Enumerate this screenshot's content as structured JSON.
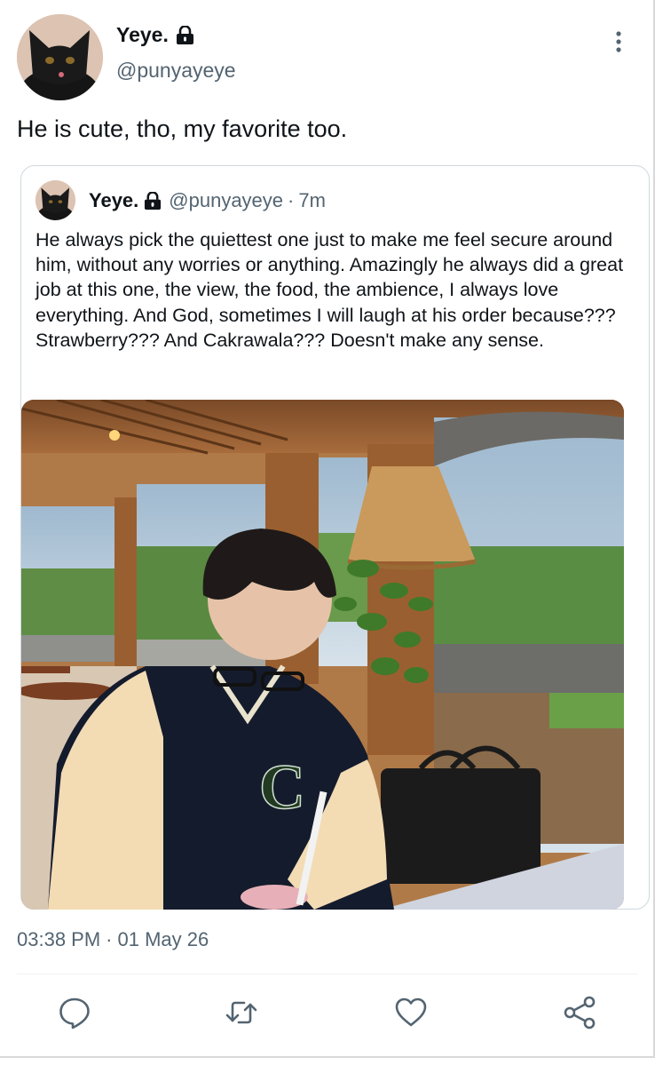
{
  "tweet": {
    "author": {
      "display_name": "Yeye.",
      "handle": "@punyayeye",
      "avatar": "black-cat-avatar",
      "protected_icon": "lock-icon"
    },
    "text": "He is cute, tho, my favorite too.",
    "timestamp_time": "03:38 PM",
    "timestamp_sep": "·",
    "timestamp_date": "01 May 26"
  },
  "quoted_tweet": {
    "author": {
      "display_name": "Yeye.",
      "handle": "@punyayeye",
      "avatar": "black-cat-avatar"
    },
    "sep": "·",
    "time_ago": "7m",
    "text": "He always pick the quiettest one just to make me feel secure around him, without any worries or anything. Amazingly he always did a great job at this one, the view, the food, the ambience, I always love everything. And God, sometimes I will laugh at his order because??? Strawberry??? And Cakrawala??? Doesn't make any sense.",
    "photo": "photo of a person in a varsity jacket sitting at a cafe table by large windows with green hills"
  },
  "actions": [
    "reply-icon",
    "retweet-icon",
    "like-icon",
    "share-icon"
  ],
  "colors": {
    "text": "#0f1419",
    "secondary": "#536471",
    "border": "#cfd9de"
  }
}
